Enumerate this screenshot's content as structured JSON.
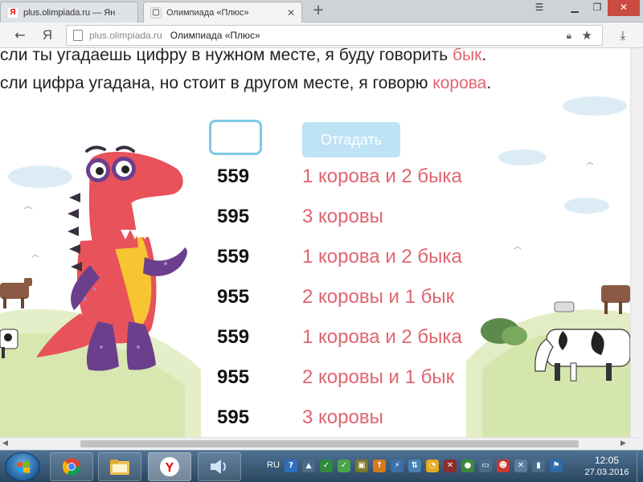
{
  "browser": {
    "tabs": [
      {
        "title": "plus.olimpiada.ru — Ян",
        "active": false
      },
      {
        "title": "Олимпиада «Плюс»",
        "active": true
      }
    ],
    "new_tab": "+",
    "address": {
      "domain": "plus.olimpiada.ru",
      "title": "Олимпиада «Плюс»"
    },
    "ya_label": "Я"
  },
  "page": {
    "instruction_1": {
      "text": "сли ты угадаешь цифру в нужном месте, я буду говорить ",
      "keyword": "бык",
      "tail": "."
    },
    "instruction_2": {
      "text": "сли цифра угадана, но стоит в другом месте, я говорю ",
      "keyword": "корова",
      "tail": "."
    },
    "input_value": "",
    "guess_button": "Отгадать",
    "attempts": [
      {
        "number": "559",
        "result": "1 корова и 2 быка"
      },
      {
        "number": "595",
        "result": "3 коровы"
      },
      {
        "number": "559",
        "result": "1 корова и 2 быка"
      },
      {
        "number": "955",
        "result": "2 коровы и 1 бык"
      },
      {
        "number": "559",
        "result": "1 корова и 2 быка"
      },
      {
        "number": "955",
        "result": "2 коровы и 1 бык"
      },
      {
        "number": "595",
        "result": "3 коровы"
      }
    ]
  },
  "taskbar": {
    "language": "RU",
    "time": "12:05",
    "date": "27.03.2016",
    "apps": [
      "chrome-icon",
      "file-explorer-icon",
      "yandex-browser-icon",
      "sound-icon"
    ]
  },
  "colors": {
    "accent_red": "#e0656e",
    "button_blue": "#bde3f4",
    "input_border": "#7fc8e6"
  }
}
